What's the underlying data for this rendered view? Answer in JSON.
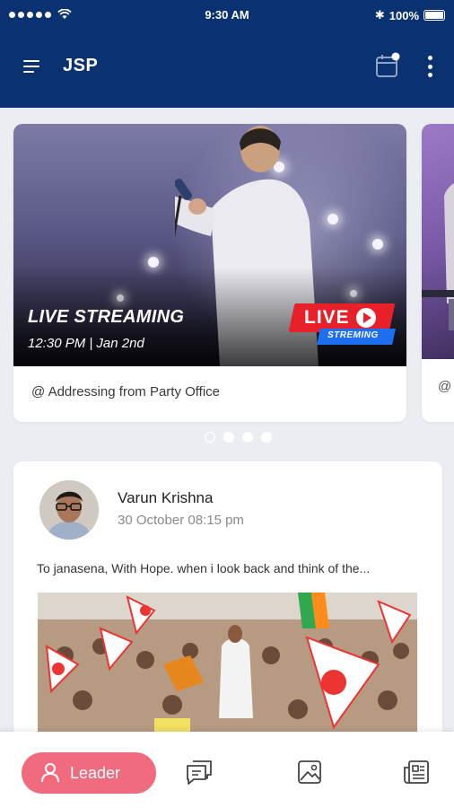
{
  "status_bar": {
    "time": "9:30 AM",
    "battery": "100%",
    "bluetooth": "✱"
  },
  "app_bar": {
    "title": "JSP",
    "icons": [
      "menu-icon",
      "calendar-icon",
      "more-vertical-icon"
    ]
  },
  "live_carousel": {
    "items": [
      {
        "title": "LIVE STREAMING",
        "time": "12:30 PM | Jan 2nd",
        "badge_live": "LIVE",
        "badge_sub": "STREMING",
        "caption": "@ Addressing from Party Office"
      },
      {
        "caption": "@"
      }
    ],
    "page_count": 4,
    "active_index": 0
  },
  "post": {
    "author": "Varun Krishna",
    "date": "30 October 08:15 pm",
    "text": "To janasena, With Hope. when i look back and think of the..."
  },
  "bottom_nav": {
    "active_label": "Leader",
    "items": [
      "user-icon",
      "chat-icon",
      "gallery-icon",
      "news-icon"
    ]
  },
  "colors": {
    "primary": "#0a3270",
    "accent": "#ef6b7d",
    "live_red": "#e8202a",
    "live_blue": "#1e6ff0"
  }
}
